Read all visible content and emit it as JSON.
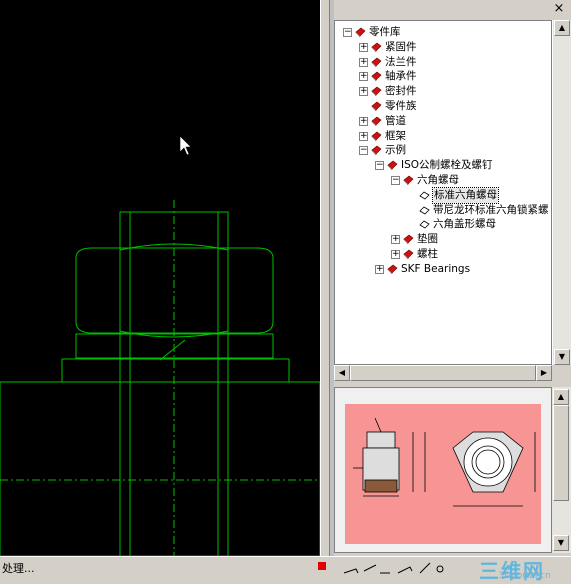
{
  "status": {
    "text": "处理..."
  },
  "watermark": {
    "cn": "三维网",
    "en": "3Dportal.cn"
  },
  "tree": {
    "items": [
      {
        "label": "零件库",
        "level": 0,
        "expander": "⊟",
        "icon": "book-icon"
      },
      {
        "label": "紧固件",
        "level": 1,
        "expander": "+",
        "icon": "book-icon"
      },
      {
        "label": "法兰件",
        "level": 1,
        "expander": "+",
        "icon": "book-icon"
      },
      {
        "label": "轴承件",
        "level": 1,
        "expander": "+",
        "icon": "book-icon"
      },
      {
        "label": "密封件",
        "level": 1,
        "expander": "+",
        "icon": "book-icon"
      },
      {
        "label": "零件族",
        "level": 1,
        "expander": "",
        "icon": "book-icon"
      },
      {
        "label": "管道",
        "level": 1,
        "expander": "+",
        "icon": "book-icon"
      },
      {
        "label": "框架",
        "level": 1,
        "expander": "+",
        "icon": "book-icon"
      },
      {
        "label": "示例",
        "level": 1,
        "expander": "−",
        "icon": "book-icon"
      },
      {
        "label": "ISO公制螺栓及螺钉",
        "level": 2,
        "expander": "−",
        "icon": "book-icon"
      },
      {
        "label": "六角螺母",
        "level": 3,
        "expander": "−",
        "icon": "book-icon"
      },
      {
        "label": "标准六角螺母",
        "level": 4,
        "expander": "",
        "icon": "part-icon",
        "selected": true
      },
      {
        "label": "带尼龙环标准六角锁紧螺",
        "level": 4,
        "expander": "",
        "icon": "part-icon"
      },
      {
        "label": "六角盖形螺母",
        "level": 4,
        "expander": "",
        "icon": "part-icon"
      },
      {
        "label": "垫圈",
        "level": 3,
        "expander": "+",
        "icon": "book-icon"
      },
      {
        "label": "螺柱",
        "level": 3,
        "expander": "+",
        "icon": "book-icon"
      },
      {
        "label": "SKF Bearings",
        "level": 2,
        "expander": "+",
        "icon": "book-icon"
      }
    ]
  },
  "colors": {
    "canvas_bg": "#000000",
    "cad_line": "#00c000",
    "preview_bg": "#f79494",
    "book_red": "#d01010"
  }
}
